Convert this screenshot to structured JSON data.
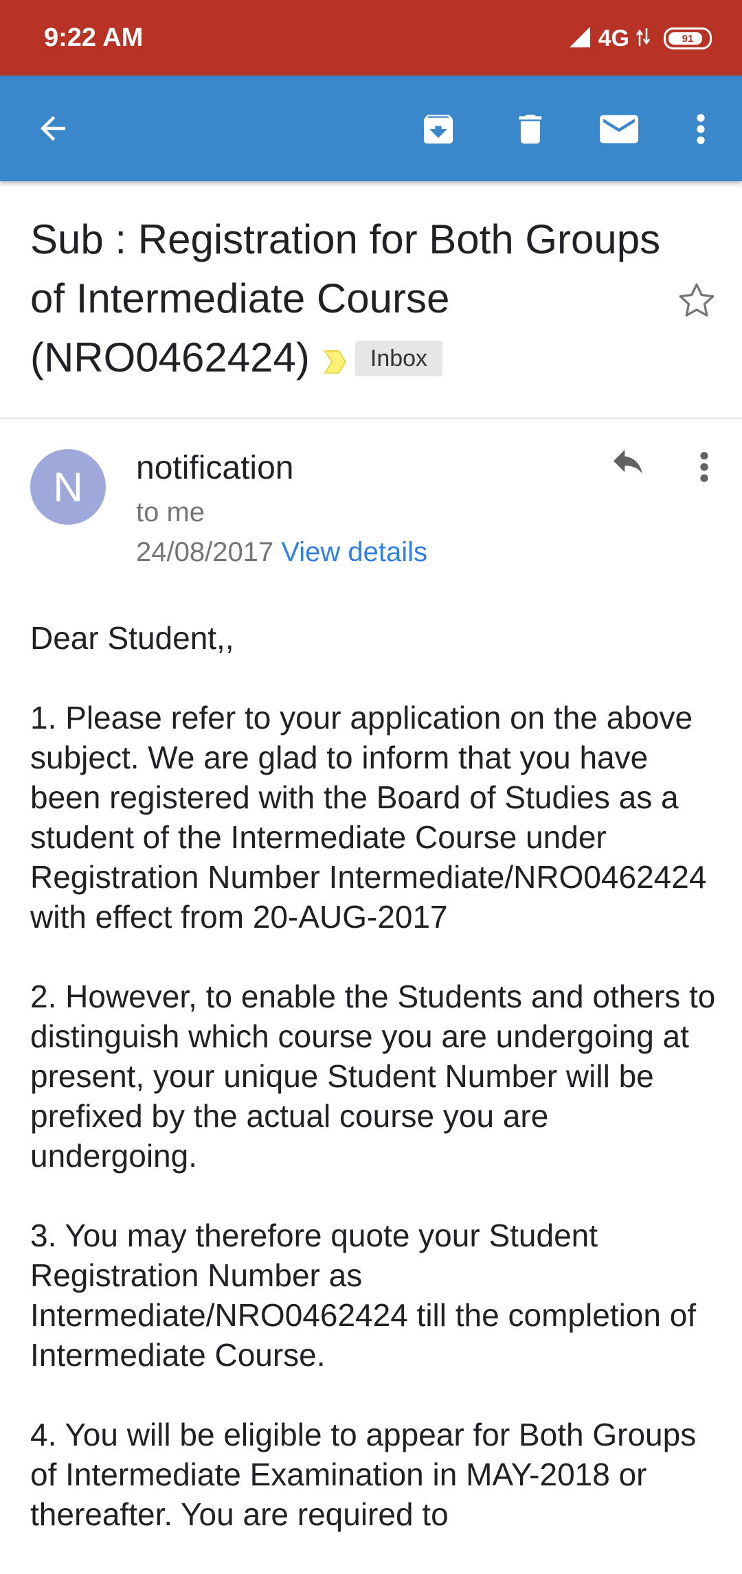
{
  "status_bar": {
    "time": "9:22 AM",
    "network": "4G",
    "battery_level": 91,
    "battery_text": "91",
    "bar_color": "#b93226"
  },
  "toolbar": {
    "bar_color": "#3a87cc",
    "icons": [
      "back-arrow-icon",
      "archive-icon",
      "delete-icon",
      "mail-icon",
      "overflow-menu-icon"
    ]
  },
  "email": {
    "subject": "Sub : Registration for Both Groups of Intermediate Course (NRO0462424)",
    "label_chip": "Inbox",
    "starred": false
  },
  "sender": {
    "avatar_letter": "N",
    "avatar_color": "#9fa8da",
    "name": "notification",
    "recipient": "to me",
    "date": "24/08/2017",
    "details_link": "View details"
  },
  "body": {
    "greeting": "Dear Student,,",
    "paragraphs": [
      "1. Please refer to your application on the above subject. We are glad to inform that you have been registered with the Board of Studies as a student of the Intermediate Course under Registration Number Intermediate/NRO0462424 with effect from 20-AUG-2017",
      "2. However, to enable the Students and others to distinguish which course you are undergoing at present, your unique Student Number will be prefixed by the actual course you are undergoing.",
      "3. You may therefore quote your Student Registration Number as Intermediate/NRO0462424 till the completion of Intermediate Course.",
      "4. You will be eligible to appear for Both Groups of Intermediate Examination in MAY-2018 or thereafter. You are required to"
    ]
  }
}
